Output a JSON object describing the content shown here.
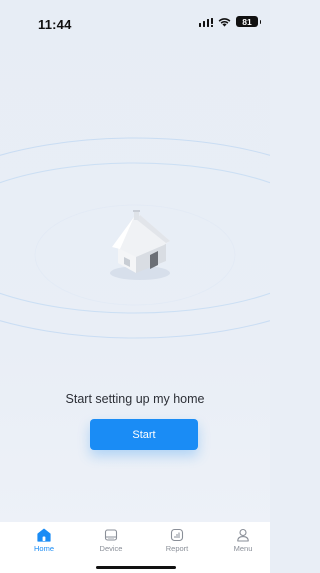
{
  "status_bar": {
    "time": "11:44",
    "battery": "81"
  },
  "hero": {
    "illustration": "house-icon",
    "text": "Start setting up my home"
  },
  "start_button": {
    "label": "Start"
  },
  "tab_bar": {
    "items": [
      {
        "label": "Home",
        "icon": "home-icon",
        "active": true
      },
      {
        "label": "Device",
        "icon": "device-icon",
        "active": false
      },
      {
        "label": "Report",
        "icon": "report-icon",
        "active": false
      },
      {
        "label": "Menu",
        "icon": "user-icon",
        "active": false
      }
    ]
  },
  "colors": {
    "accent": "#1a8cf5",
    "background": "#e9eef6",
    "inactive": "#8a8f98"
  }
}
